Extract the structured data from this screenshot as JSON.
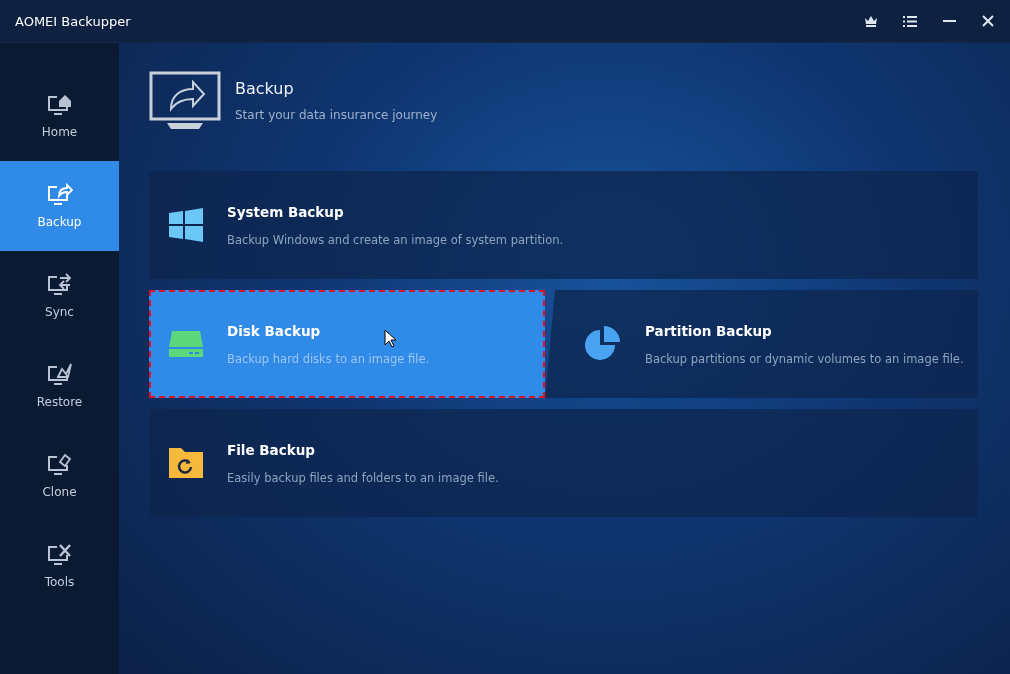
{
  "window": {
    "title": "AOMEI Backupper"
  },
  "sidebar": {
    "items": [
      {
        "label": "Home",
        "kind": "home",
        "selected": false
      },
      {
        "label": "Backup",
        "kind": "backup",
        "selected": true
      },
      {
        "label": "Sync",
        "kind": "sync",
        "selected": false
      },
      {
        "label": "Restore",
        "kind": "restore",
        "selected": false
      },
      {
        "label": "Clone",
        "kind": "clone",
        "selected": false
      },
      {
        "label": "Tools",
        "kind": "tools",
        "selected": false
      }
    ]
  },
  "header": {
    "title": "Backup",
    "subtitle": "Start your data insurance journey"
  },
  "options": [
    [
      {
        "kind": "system",
        "title": "System Backup",
        "description": "Backup Windows and create an image of system partition.",
        "selected": false
      }
    ],
    [
      {
        "kind": "disk",
        "title": "Disk Backup",
        "description": "Backup hard disks to an image file.",
        "selected": true
      },
      {
        "kind": "partition",
        "title": "Partition Backup",
        "description": "Backup partitions or dynamic volumes to an image file.",
        "selected": false
      }
    ],
    [
      {
        "kind": "file",
        "title": "File Backup",
        "description": "Easily backup files and folders to an image file.",
        "selected": false
      }
    ]
  ]
}
